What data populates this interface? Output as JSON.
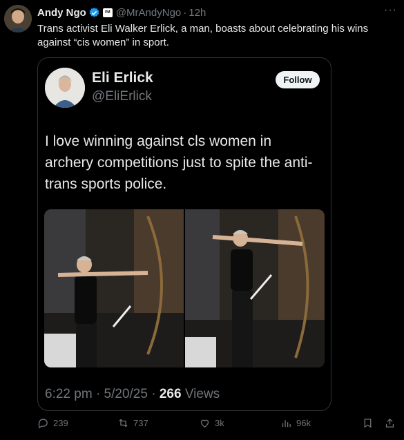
{
  "author": {
    "name": "Andy Ngo",
    "handle": "@MrAndyNgo",
    "time": "12h",
    "affiliate_badge": "PM"
  },
  "tweet": {
    "text": "Trans activist Eli Walker Erlick, a man, boasts about celebrating his wins against “cis women” in sport."
  },
  "quoted": {
    "name": "Eli Erlick",
    "handle": "@EliErlick",
    "follow_label": "Follow",
    "text": "I love winning against cls women in archery competitions just to spite the anti-trans sports police.",
    "time": "6:22 pm",
    "date": "5/20/25",
    "views_count": "266",
    "views_label": "Views"
  },
  "actions": {
    "replies": "239",
    "reposts": "737",
    "likes": "3k",
    "views": "96k"
  },
  "colors": {
    "background": "#000000",
    "text": "#e7e9ea",
    "muted": "#71767b",
    "verified": "#1d9bf0",
    "border": "#2f3336"
  }
}
